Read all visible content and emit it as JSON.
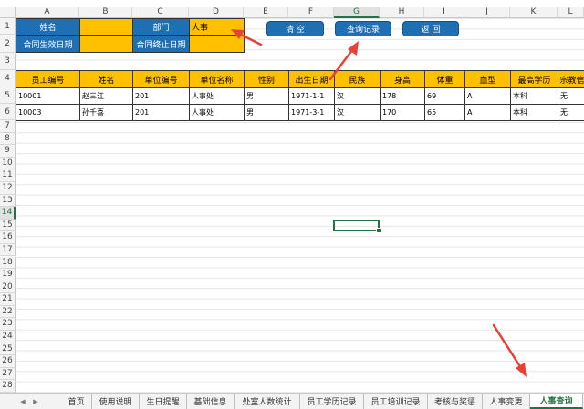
{
  "columns": [
    "A",
    "B",
    "C",
    "D",
    "E",
    "F",
    "G",
    "H",
    "I",
    "J",
    "K",
    "L"
  ],
  "rows": [
    "1",
    "2",
    "3",
    "4",
    "5",
    "6",
    "7",
    "8",
    "9",
    "10",
    "11",
    "12",
    "13",
    "14",
    "15",
    "16",
    "17",
    "18",
    "19",
    "20",
    "21",
    "22",
    "23",
    "24",
    "25",
    "26",
    "27",
    "28"
  ],
  "form": {
    "name_label": "姓名",
    "name_value": "",
    "dept_label": "部门",
    "dept_value": "人事",
    "start_label": "合同生效日期",
    "start_value": "",
    "end_label": "合同终止日期",
    "end_value": ""
  },
  "buttons": {
    "clear": "清  空",
    "query": "查询记录",
    "back": "返  回"
  },
  "table": {
    "headers": [
      "员工编号",
      "姓名",
      "单位编号",
      "单位名称",
      "性别",
      "出生日期",
      "民族",
      "身高",
      "体重",
      "血型",
      "最高学历",
      "宗教信"
    ],
    "rows": [
      [
        "10001",
        "赵三江",
        "201",
        "人事处",
        "男",
        "1971-1-1",
        "汉",
        "178",
        "69",
        "A",
        "本科",
        "无"
      ],
      [
        "10003",
        "孙千喜",
        "201",
        "人事处",
        "男",
        "1971-3-1",
        "汉",
        "170",
        "65",
        "A",
        "本科",
        "无"
      ]
    ]
  },
  "sheet_tabs": [
    "首页",
    "使用说明",
    "生日提醒",
    "基础信息",
    "处室人数统计",
    "员工学历记录",
    "员工培训记录",
    "考核与奖惩",
    "人事变更",
    "人事查询"
  ],
  "active_tab": "人事查询",
  "accent_color": "#217346",
  "header_blue": "#1f6fb5",
  "header_yellow": "#ffc000"
}
